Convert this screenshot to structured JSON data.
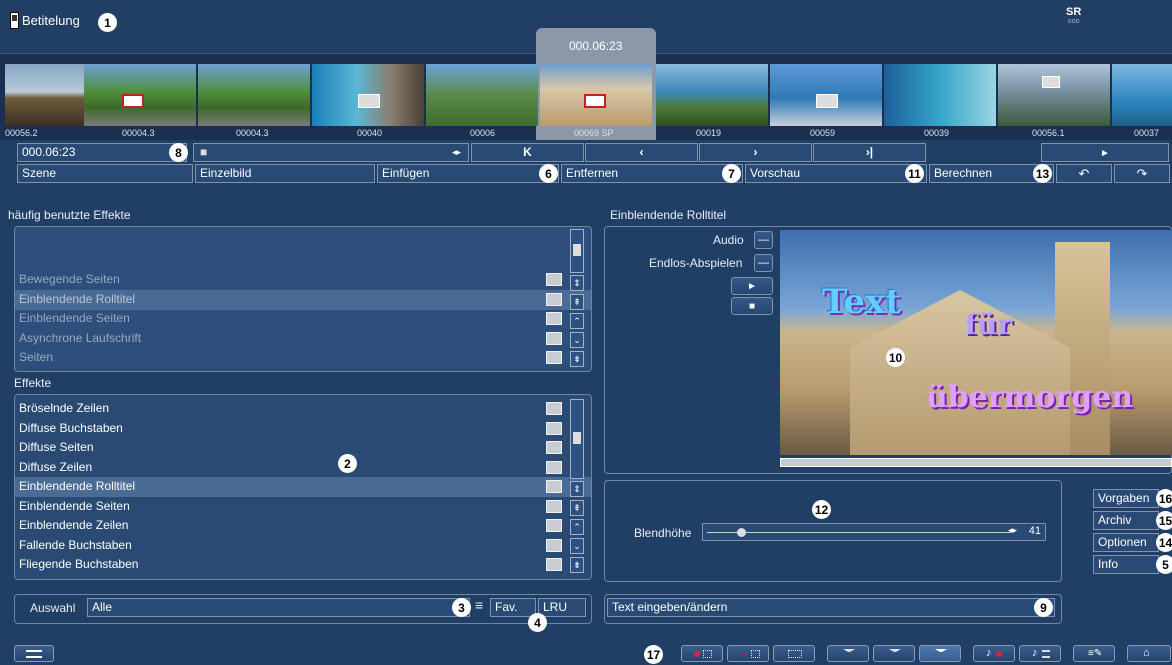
{
  "header": {
    "title": "Betitelung",
    "logo": "SR",
    "logo_sub": "ooo"
  },
  "timeline": {
    "current_time": "000.06:23",
    "scenes": [
      {
        "label": "00056.2"
      },
      {
        "label": "00004.3"
      },
      {
        "label": "00004.3"
      },
      {
        "label": "00040"
      },
      {
        "label": "00006"
      },
      {
        "label": "00069 SP",
        "selected": true
      },
      {
        "label": "00019"
      },
      {
        "label": "00059"
      },
      {
        "label": "00039"
      },
      {
        "label": "00056.1"
      },
      {
        "label": "00037"
      }
    ]
  },
  "transport": {
    "time_field": "000.06:23",
    "stop_glyph": "■",
    "scrub_glyph": "◂▸",
    "first_glyph": "K",
    "prev_glyph": "‹",
    "next_glyph": "›",
    "last_glyph": "›|",
    "play_glyph": "►"
  },
  "toolbar": {
    "scene": "Szene",
    "single_frame": "Einzelbild",
    "insert": "Einfügen",
    "remove": "Entfernen",
    "preview": "Vorschau",
    "calculate": "Berechnen",
    "undo_glyph": "↶",
    "redo_glyph": "↷"
  },
  "frequent": {
    "title": "häufig benutzte Effekte",
    "items": [
      "Bewegende Seiten",
      "Einblendende Rolltitel",
      "Einblendende Seiten",
      "Asynchrone Laufschrift",
      "Seiten"
    ],
    "selected_index": 1
  },
  "effects": {
    "title": "Effekte",
    "items": [
      "Bröselnde Zeilen",
      "Diffuse Buchstaben",
      "Diffuse Seiten",
      "Diffuse Zeilen",
      "Einblendende Rolltitel",
      "Einblendende Seiten",
      "Einblendende Zeilen",
      "Fallende Buchstaben",
      "Fliegende Buchstaben"
    ],
    "selected_index": 4
  },
  "selection": {
    "label": "Auswahl",
    "value": "Alle",
    "fav": "Fav.",
    "lru": "LRU",
    "menu_glyph": "≡"
  },
  "preview": {
    "title": "Einblendende Rolltitel",
    "audio": "Audio",
    "loop": "Endlos-Abspielen",
    "toggle_glyph": "—",
    "play_glyph": "►",
    "stop_glyph": "■",
    "overlay_text": [
      "Text",
      "für",
      "übermorgen"
    ]
  },
  "blend": {
    "label": "Blendhöhe",
    "value": "41",
    "level": 0.1
  },
  "text_button": "Text eingeben/ändern",
  "side_buttons": {
    "presets": "Vorgaben",
    "archive": "Archiv",
    "options": "Optionen",
    "info": "Info"
  },
  "badges": [
    "1",
    "2",
    "3",
    "4",
    "5",
    "6",
    "7",
    "8",
    "9",
    "10",
    "11",
    "12",
    "13",
    "14",
    "15",
    "16",
    "17"
  ],
  "colors": {
    "background": "#213e64",
    "panel": "#2a4a74",
    "selected_row": "#4a6b95",
    "accent_red": "#e0203a",
    "badge": "#ffffff"
  }
}
